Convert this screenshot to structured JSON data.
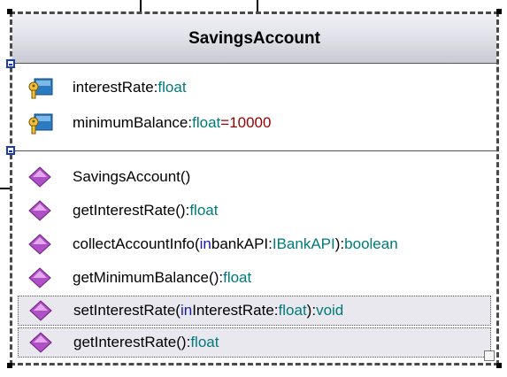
{
  "class_name": "SavingsAccount",
  "attributes": [
    {
      "name": "interestRate",
      "colon": ":",
      "type": "float",
      "default": ""
    },
    {
      "name": "minimumBalance",
      "colon": ":",
      "type": "float",
      "default": "=10000"
    }
  ],
  "operations": [
    {
      "name": "SavingsAccount",
      "open": "(",
      "param_kw": "",
      "param": "",
      "param_colon": "",
      "param_type": "",
      "close": ")",
      "colon": "",
      "return_type": ""
    },
    {
      "name": "getInterestRate",
      "open": "(",
      "param_kw": "",
      "param": "",
      "param_colon": "",
      "param_type": "",
      "close": ")",
      "colon": ":",
      "return_type": "float"
    },
    {
      "name": "collectAccountInfo",
      "open": "(",
      "param_kw": "in",
      "param": " bankAPI",
      "param_colon": ":",
      "param_type": "IBankAPI",
      "close": ")",
      "colon": ":",
      "return_type": "boolean"
    },
    {
      "name": "getMinimumBalance",
      "open": "(",
      "param_kw": "",
      "param": "",
      "param_colon": "",
      "param_type": "",
      "close": ")",
      "colon": ":",
      "return_type": "float"
    },
    {
      "name": "setInterestRate",
      "open": "(",
      "param_kw": "in",
      "param": " InterestRate",
      "param_colon": ":",
      "param_type": "float",
      "close": ")",
      "colon": ":",
      "return_type": "void"
    },
    {
      "name": "getInterestRate",
      "open": "(",
      "param_kw": "",
      "param": "",
      "param_colon": "",
      "param_type": "",
      "close": ")",
      "colon": ":",
      "return_type": "float"
    }
  ],
  "selected_operations": [
    4,
    5
  ],
  "colors": {
    "keyword": "#1a1aa8",
    "type": "#007a7a",
    "default_value": "#990000",
    "operation_icon": "#b050c8",
    "attribute_icon": "#2a7bbf"
  },
  "icons": {
    "attribute": "private-attribute-key-icon",
    "operation": "operation-diamond-icon"
  }
}
